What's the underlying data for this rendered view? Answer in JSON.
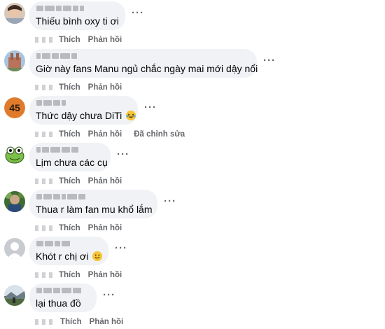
{
  "colors": {
    "bubble": "#f0f2f5",
    "meta_text": "#65676b",
    "text": "#050505"
  },
  "comments": [
    {
      "avatar": "avatar-child-photo",
      "text": "Thiếu bình oxy ti ơi",
      "like": "Thích",
      "reply": "Phản hồi",
      "more": "···"
    },
    {
      "avatar": "avatar-building-photo",
      "text": "Giờ này fans Manu ngủ chắc ngày mai mới dậy nổi",
      "like": "Thích",
      "reply": "Phản hồi",
      "more": "···"
    },
    {
      "avatar": "avatar-45-logo",
      "avatar_text": "45",
      "text": "Thức dậy chưa DiTi",
      "emoji": "laughing-tears-emoji",
      "like": "Thích",
      "reply": "Phản hồi",
      "edited": "Đã chỉnh sửa",
      "more": "···"
    },
    {
      "avatar": "avatar-frog-cartoon",
      "text": "Lịm chưa các cụ",
      "like": "Thích",
      "reply": "Phản hồi",
      "more": "···"
    },
    {
      "avatar": "avatar-green-photo",
      "text": "Thua r làm fan mu khổ lắm",
      "like": "Thích",
      "reply": "Phản hồi",
      "more": "···"
    },
    {
      "avatar": "avatar-default-user",
      "text": "Khót r chị ơi",
      "emoji": "smile-emoji",
      "like": "Thích",
      "reply": "Phản hồi",
      "more": "···"
    },
    {
      "avatar": "avatar-landscape-photo",
      "text": "lại thua đồ",
      "like": "Thích",
      "reply": "Phản hồi",
      "more": "···"
    }
  ]
}
